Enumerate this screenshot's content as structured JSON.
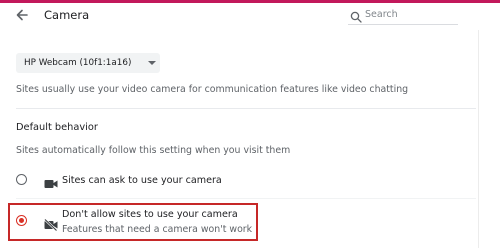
{
  "header": {
    "title": "Camera",
    "back_icon": "arrow-left-icon"
  },
  "search": {
    "placeholder": "Search",
    "icon": "search-icon"
  },
  "device_select": {
    "selected": "HP Webcam (10f1:1a16)"
  },
  "description": "Sites usually use your video camera for communication features like video chatting",
  "default_behavior": {
    "title": "Default behavior",
    "description": "Sites automatically follow this setting when you visit them",
    "options": [
      {
        "label": "Sites can ask to use your camera",
        "checked": false,
        "icon": "videocam-icon"
      },
      {
        "label": "Don't allow sites to use your camera",
        "sublabel": "Features that need a camera won't work",
        "checked": true,
        "icon": "videocam-off-icon"
      }
    ]
  },
  "colors": {
    "accent": "#d93025",
    "highlight_border": "#c62828",
    "top_bar": "#c2185b"
  }
}
